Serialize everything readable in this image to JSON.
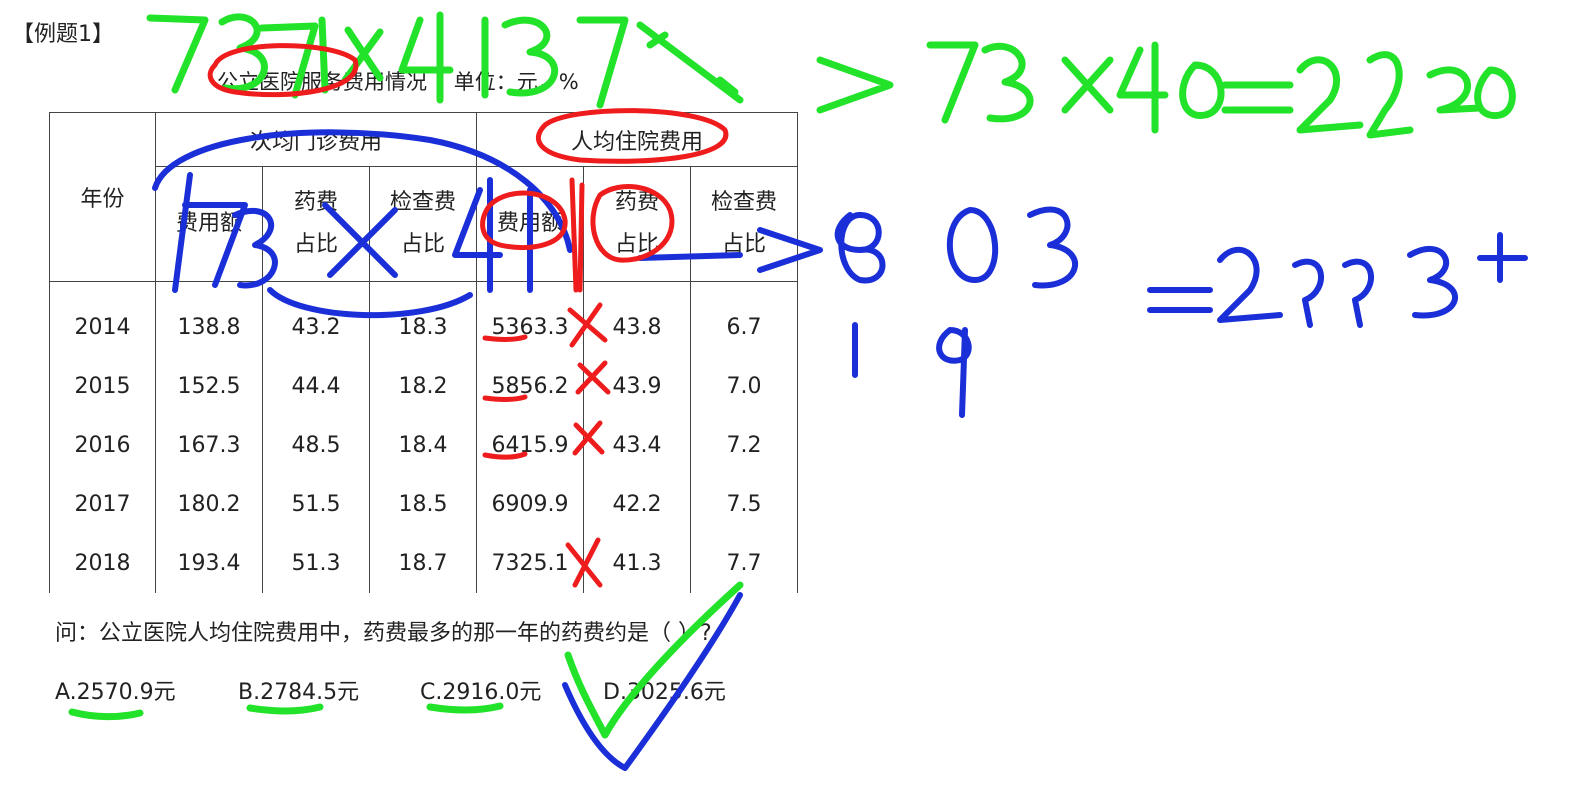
{
  "example_tag": "【例题1】",
  "table": {
    "title": "公立医院服务费用情况    单位：元，%",
    "year_header": "年份",
    "group_headers": [
      "次均门诊费用",
      "人均住院费用"
    ],
    "sub_headers": [
      "费用额",
      "药费\n占比",
      "检查费\n占比",
      "费用额",
      "药费\n占比",
      "检查费\n占比"
    ],
    "rows": [
      [
        "2014",
        "138.8",
        "43.2",
        "18.3",
        "5363.3",
        "43.8",
        "6.7"
      ],
      [
        "2015",
        "152.5",
        "44.4",
        "18.2",
        "5856.2",
        "43.9",
        "7.0"
      ],
      [
        "2016",
        "167.3",
        "48.5",
        "18.4",
        "6415.9",
        "43.4",
        "7.2"
      ],
      [
        "2017",
        "180.2",
        "51.5",
        "18.5",
        "6909.9",
        "42.2",
        "7.5"
      ],
      [
        "2018",
        "193.4",
        "51.3",
        "18.7",
        "7325.1",
        "41.3",
        "7.7"
      ]
    ]
  },
  "question": "问：公立医院人均住院费用中，药费最多的那一年的药费约是（  ）?",
  "options": [
    "A.2570.9元",
    "B.2784.5元",
    "C.2916.0元",
    "D.3025.6元"
  ],
  "ink_colors": {
    "green": "#22e22a",
    "blue": "#1a2fd8",
    "red": "#ee1c1c"
  }
}
